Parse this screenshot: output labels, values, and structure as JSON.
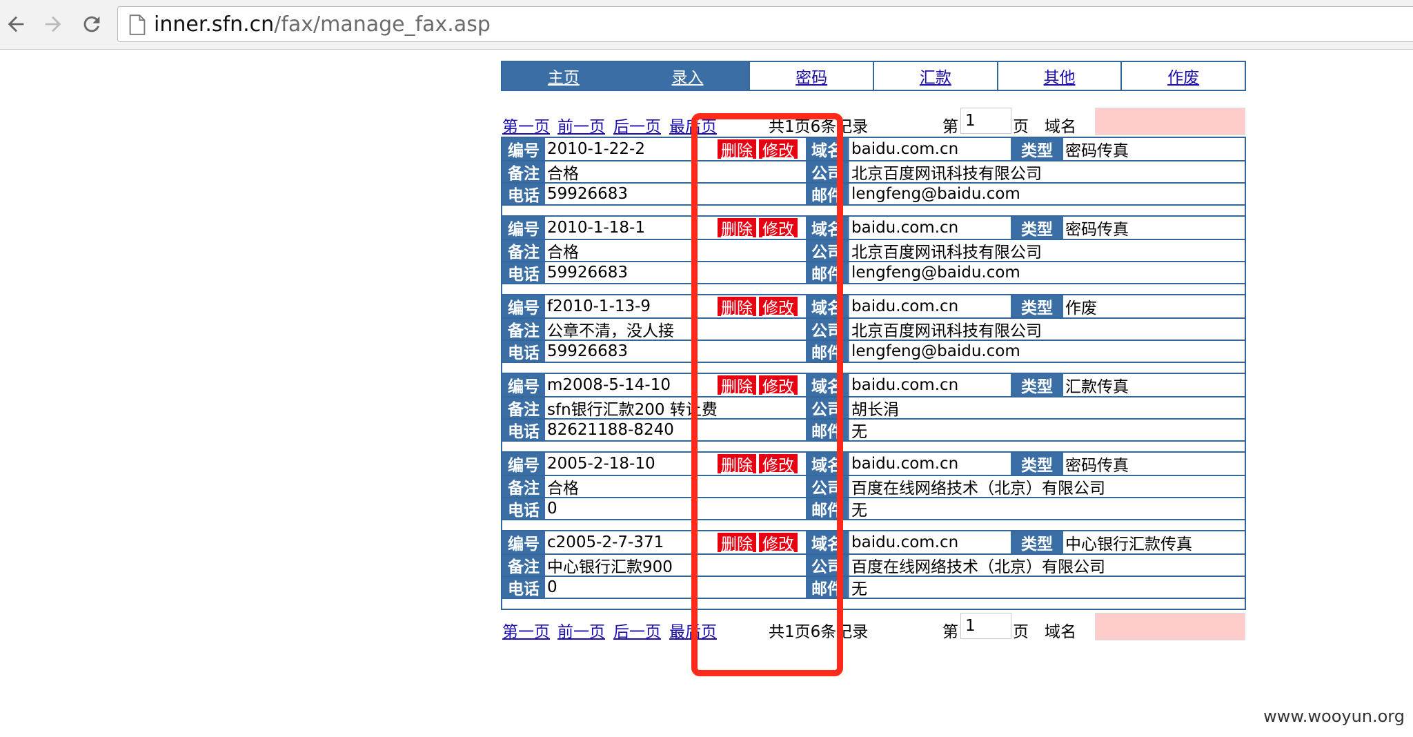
{
  "browser": {
    "url_host": "inner.sfn.cn",
    "url_path": "/fax/manage_fax.asp"
  },
  "nav": [
    "主页",
    "录入",
    "密码",
    "汇款",
    "其他",
    "作废"
  ],
  "pager": {
    "first": "第一页",
    "prev": "前一页",
    "next": "后一页",
    "last": "最后页",
    "summary": "共1页6条记录",
    "page_label_pre": "第",
    "page_value": "1",
    "page_label_post": "页",
    "domain_label": "域名"
  },
  "labels": {
    "id": "编号",
    "note": "备注",
    "phone": "电话",
    "domain": "域名",
    "company": "公司",
    "email": "邮件",
    "type": "类型",
    "delete": "删除",
    "edit": "修改"
  },
  "records": [
    {
      "id": "2010-1-22-2",
      "note": "合格",
      "phone": "59926683",
      "domain": "baidu.com.cn",
      "type": "密码传真",
      "company": "北京百度网讯科技有限公司",
      "email": "lengfeng@baidu.com"
    },
    {
      "id": "2010-1-18-1",
      "note": "合格",
      "phone": "59926683",
      "domain": "baidu.com.cn",
      "type": "密码传真",
      "company": "北京百度网讯科技有限公司",
      "email": "lengfeng@baidu.com"
    },
    {
      "id": "f2010-1-13-9",
      "note": "公章不清，没人接",
      "phone": "59926683",
      "domain": "baidu.com.cn",
      "type": "作废",
      "company": "北京百度网讯科技有限公司",
      "email": "lengfeng@baidu.com"
    },
    {
      "id": "m2008-5-14-10",
      "note": "sfn银行汇款200 转让费",
      "phone": "82621188-8240",
      "domain": "baidu.com.cn",
      "type": "汇款传真",
      "company": "胡长涓",
      "email": "无"
    },
    {
      "id": "2005-2-18-10",
      "note": "合格",
      "phone": "0",
      "domain": "baidu.com.cn",
      "type": "密码传真",
      "company": "百度在线网络技术（北京）有限公司",
      "email": "无"
    },
    {
      "id": "c2005-2-7-371",
      "note": "中心银行汇款900",
      "phone": "0",
      "domain": "baidu.com.cn",
      "type": "中心银行汇款传真",
      "company": "百度在线网络技术（北京）有限公司",
      "email": "无"
    }
  ],
  "watermark": "www.wooyun.org"
}
